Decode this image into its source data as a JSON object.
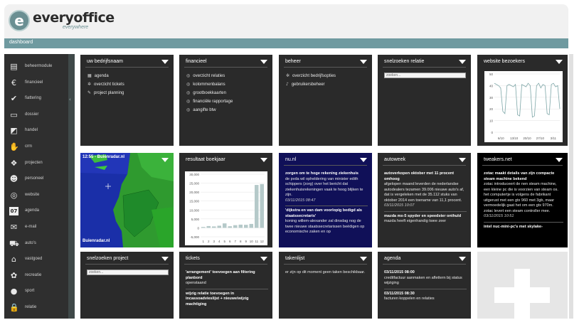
{
  "brand": {
    "name": "everyoffice",
    "tagline": "everywhere",
    "logo_letter": "e"
  },
  "nav": {
    "title": "dashboard"
  },
  "sidebar": {
    "items": [
      {
        "label": "beheermodule",
        "icon": "server-icon",
        "glyph": "▤"
      },
      {
        "label": "financieel",
        "icon": "euro-icon",
        "glyph": "€"
      },
      {
        "label": "fiattering",
        "icon": "checkmark-icon",
        "glyph": "✔"
      },
      {
        "label": "dossier",
        "icon": "monitor-icon",
        "glyph": "▭"
      },
      {
        "label": "handel",
        "icon": "chart-icon",
        "glyph": "◩"
      },
      {
        "label": "crm",
        "icon": "handshake-icon",
        "glyph": "✋"
      },
      {
        "label": "projecten",
        "icon": "cubes-icon",
        "glyph": "❖"
      },
      {
        "label": "personeel",
        "icon": "people-icon",
        "glyph": "☻"
      },
      {
        "label": "website",
        "icon": "globe-icon",
        "glyph": "◎"
      },
      {
        "label": "agenda",
        "icon": "calendar-icon",
        "glyph": "07"
      },
      {
        "label": "e-mail",
        "icon": "envelope-icon",
        "glyph": "✉"
      },
      {
        "label": "auto's",
        "icon": "car-icon",
        "glyph": "⛟"
      },
      {
        "label": "vastgoed",
        "icon": "house-icon",
        "glyph": "⌂"
      },
      {
        "label": "recreatie",
        "icon": "flower-icon",
        "glyph": "✿"
      },
      {
        "label": "sport",
        "icon": "ball-icon",
        "glyph": "●"
      },
      {
        "label": "relatie",
        "icon": "lock-icon",
        "glyph": "🔒"
      }
    ]
  },
  "widgets": {
    "bedrijf": {
      "title": "uw bedrijfsnaam",
      "items": [
        {
          "label": "agenda",
          "icon": "calendar-icon",
          "glyph": "▦"
        },
        {
          "label": "overzicht tickets",
          "icon": "gear-icon",
          "glyph": "✲"
        },
        {
          "label": "project planning",
          "icon": "wrench-icon",
          "glyph": "✎"
        }
      ]
    },
    "financieel": {
      "title": "financieel",
      "items": [
        {
          "label": "overzicht relaties"
        },
        {
          "label": "kolommenbalans"
        },
        {
          "label": "grootboekkaarten"
        },
        {
          "label": "financiële rapportage"
        },
        {
          "label": "aangifte btw"
        }
      ]
    },
    "beheer": {
      "title": "beheer",
      "items": [
        {
          "label": "overzicht bedrijfsopties",
          "icon": "gear-icon",
          "glyph": "✲"
        },
        {
          "label": "gebruikersbeheer",
          "icon": "user-icon",
          "glyph": "♪"
        }
      ]
    },
    "snelzoeken_relatie": {
      "title": "snelzoeken relatie",
      "placeholder": "zoeken..."
    },
    "bezoekers": {
      "title": "website bezoekers",
      "x_ticks": [
        "6/10",
        "13/10",
        "20/10",
        "27/10",
        "3/11"
      ],
      "y_ticks": [
        "50",
        "40",
        "30",
        "20",
        "10",
        "0"
      ]
    },
    "radar": {
      "title": "12:55 - Buienradar.nl",
      "brand": "Buienradar.nl"
    },
    "boekjaar": {
      "title": "resultaat boekjaar"
    },
    "nu": {
      "title": "nu.nl",
      "articles": [
        {
          "headline": "zorgen om te hoge rekening ziekenhuis",
          "body": "de pvda wil opheldering van minister edith schippers (zorg) over het bericht dat ziekenhuisrekeningen vaak te hoog blijken te zijn.",
          "date": "03/11/2015 08:47"
        },
        {
          "headline": "'dijkstra en van dam voorlopig bedigd als staatssecretaris'",
          "body": "koning willem-alexander zal dinsdag nog de twee nieuwe staatssecretarissen beëdigen op economische zaken en op",
          "date": ""
        }
      ]
    },
    "autoweek": {
      "title": "autoweek",
      "articles": [
        {
          "headline": "autoverkopen oktober met 11 procent omhoog",
          "body": "afgelopen maand leverden de nederlandse autodealers tezamen 39.006 nieuwe auto's af, dat is vergeleken met de 35.112 stuks van oktober 2014 een toename van 11,1 procent.",
          "date": "03/11/2015 10:07"
        },
        {
          "headline": "mazda mx-5 spyder en speedster onthuld",
          "body": "mazda heeft eigenhandig twee zeer",
          "date": ""
        }
      ]
    },
    "tweakers": {
      "title": "tweakers.net",
      "articles": [
        {
          "headline": "zotac maakt details van zijn compacte steam machine bekend",
          "body": "zotac introduceert de nen steam machine, een kleine pc die is voorzien van steam os. het computertje is volgens de fabrikant uitgerust met een gtx 960 met 3gb, maar vermoedelijk gaat het om een gtx 970m. zotac levert een steam controller mee.",
          "date": "03/11/2015 10:51"
        },
        {
          "headline": "intel nuc-mini-pc's met skylake-",
          "body": "",
          "date": ""
        }
      ]
    },
    "snelzoeken_project": {
      "title": "snelzoeken project",
      "placeholder": "zoeken..."
    },
    "tickets": {
      "title": "tickets",
      "items": [
        {
          "headline": "'arrangement' toevoegen aan filtering planbord",
          "status": "openstaand"
        },
        {
          "headline": "wijzig relatie toevoegen in incassoadvieslijst + nieuwe/wijzig machtiging",
          "status": ""
        }
      ]
    },
    "takenlijst": {
      "title": "takenlijst",
      "message": "er zijn op dit moment geen taken beschikbaar."
    },
    "agenda": {
      "title": "agenda",
      "items": [
        {
          "date": "03/11/2015 08:00",
          "text": "creditfactuur aanmaken en aflettern bij status wijziging"
        },
        {
          "date": "03/11/2015 08:30",
          "text": "facturen koppelen en relaties"
        }
      ]
    }
  },
  "chart_data": [
    {
      "type": "line",
      "title": "website bezoekers",
      "x_ticks": [
        "6/10",
        "13/10",
        "20/10",
        "27/10",
        "3/11"
      ],
      "ylim": [
        0,
        50
      ],
      "series": [
        {
          "values": [
            42,
            41,
            40,
            38,
            18,
            16,
            40,
            41,
            40,
            39,
            41,
            15,
            14,
            41,
            40,
            39,
            42,
            40,
            13,
            14,
            40,
            42,
            38,
            41,
            40,
            16,
            15,
            41,
            42,
            39,
            40,
            20
          ]
        }
      ]
    },
    {
      "type": "bar",
      "title": "resultaat boekjaar",
      "categories": [
        "1",
        "2",
        "3",
        "4",
        "5",
        "6",
        "7",
        "8",
        "9",
        "10",
        "11",
        "12"
      ],
      "y_ticks": [
        "30,000",
        "25,000",
        "20,000",
        "15,000",
        "10,000",
        "5,000",
        "0",
        "-5,000"
      ],
      "ylim": [
        -5000,
        30000
      ],
      "values": [
        500,
        1000,
        800,
        1200,
        2500,
        900,
        1500,
        1800,
        1700,
        2200,
        24000,
        24500
      ]
    }
  ]
}
